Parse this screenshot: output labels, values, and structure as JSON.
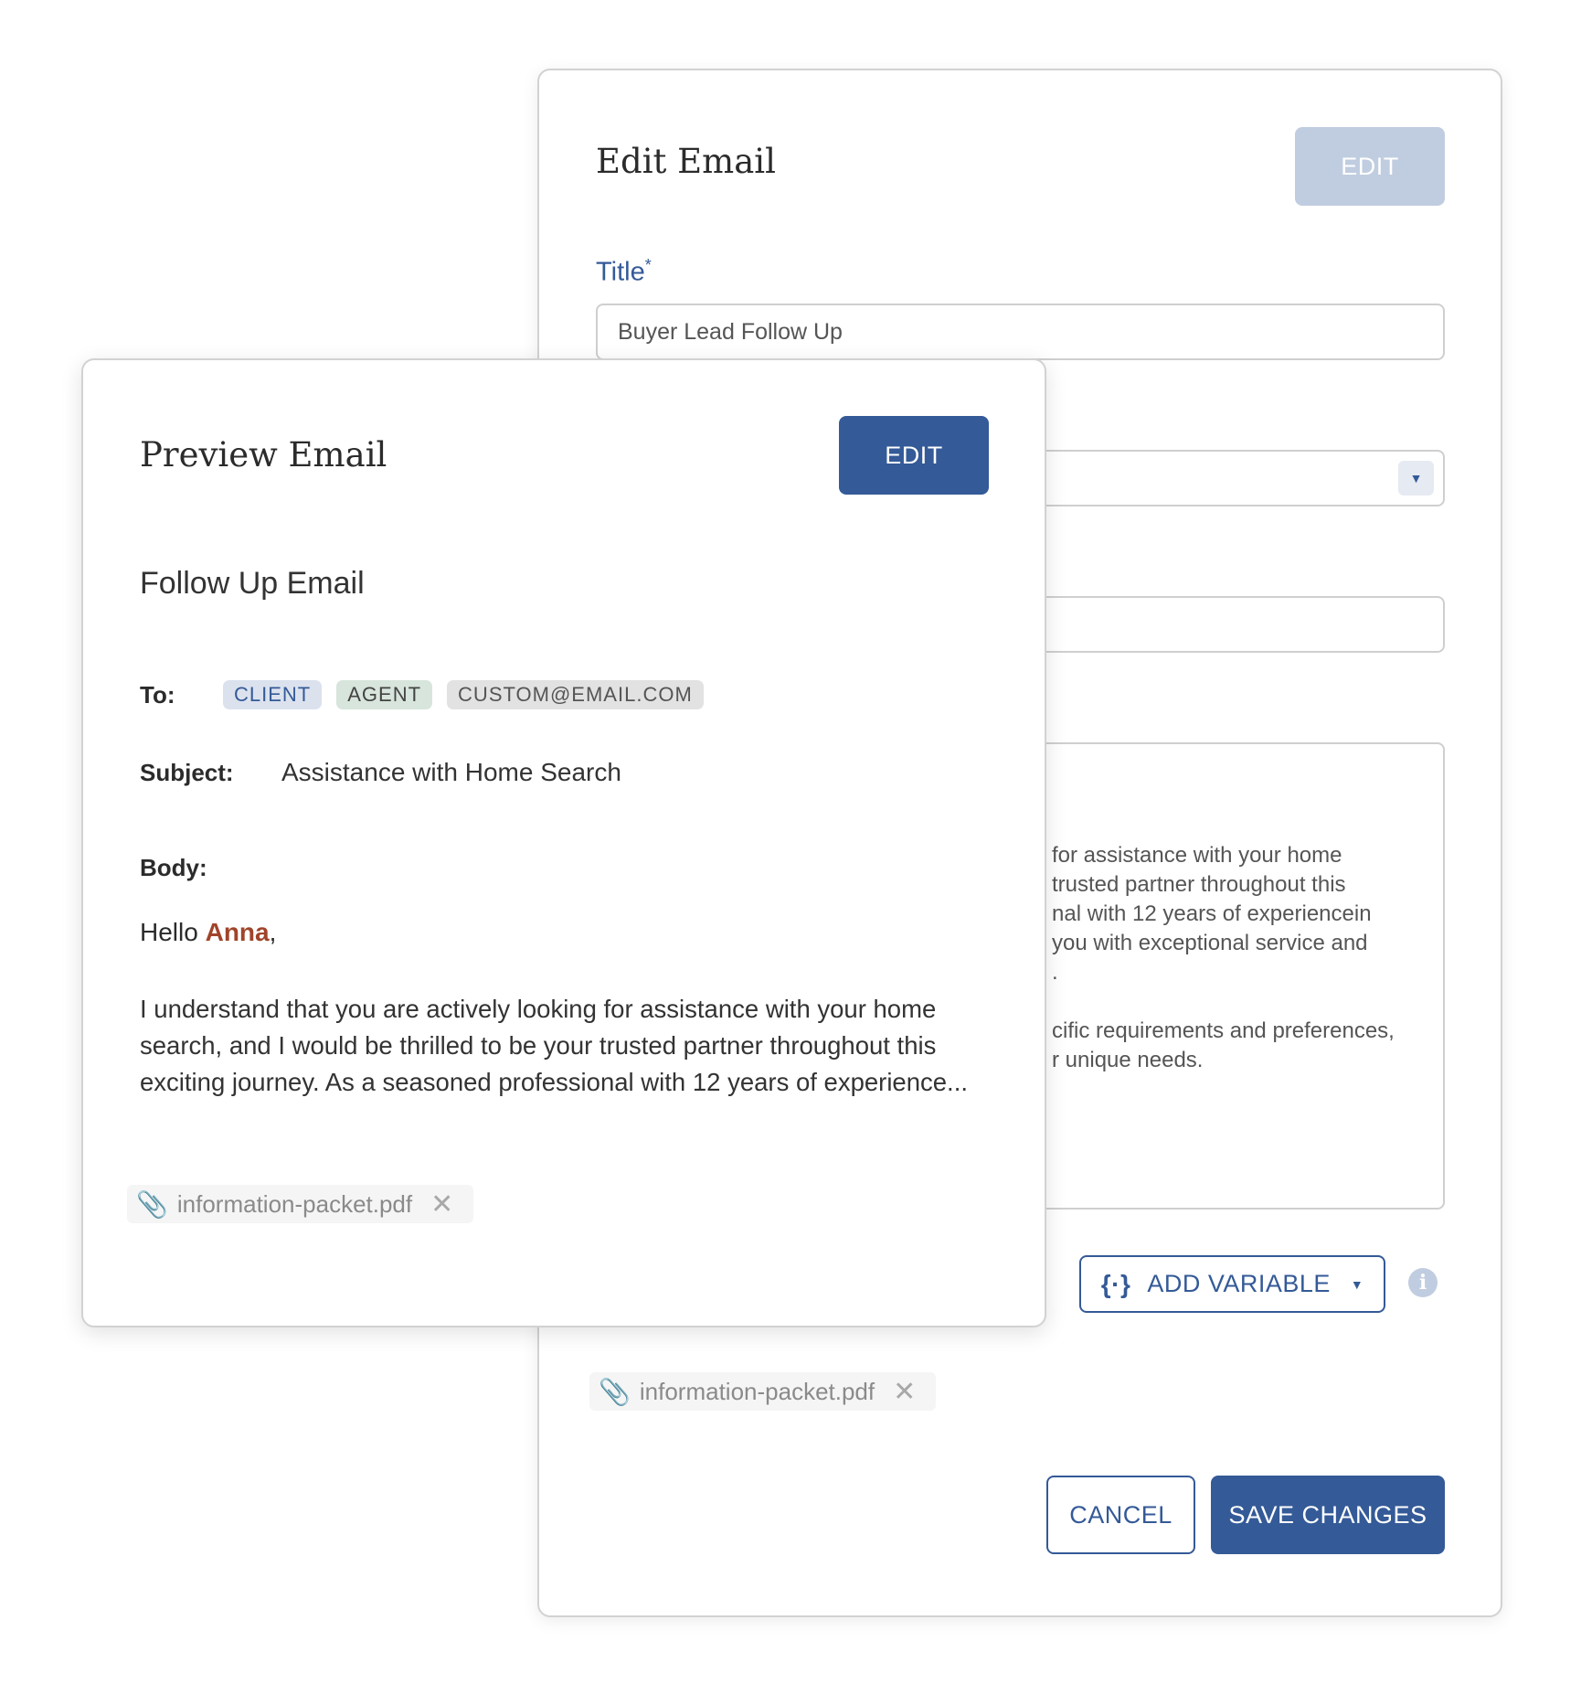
{
  "edit_email": {
    "title": "Edit Email",
    "edit_button": "EDIT",
    "title_label": "Title",
    "required_mark": "*",
    "title_value": "Buyer Lead Follow Up",
    "body_fragments": [
      "for assistance with your home",
      "trusted partner throughout this",
      "nal with 12 years of experiencein",
      "you with exceptional service and",
      ".",
      "cific requirements and preferences,",
      "r unique needs."
    ],
    "add_variable": "ADD VARIABLE",
    "attachment": "information-packet.pdf",
    "cancel": "CANCEL",
    "save": "SAVE CHANGES"
  },
  "preview_email": {
    "title": "Preview Email",
    "edit_button": "EDIT",
    "email_name": "Follow Up Email",
    "to_label": "To:",
    "recipients": [
      "CLIENT",
      "AGENT",
      "CUSTOM@EMAIL.COM"
    ],
    "subject_label": "Subject:",
    "subject": "Assistance with Home Search",
    "body_label": "Body:",
    "greeting": "Hello",
    "name": "Anna",
    "greeting_punct": ",",
    "body": "I understand that you are actively looking for assistance with your home search, and I would be thrilled to be your trusted partner throughout this exciting journey. As a seasoned professional with 12 years of experience...",
    "attachment": "information-packet.pdf"
  },
  "colors": {
    "primary": "#345a97",
    "disabled": "#c0cde0",
    "variable": "#a0442a"
  }
}
